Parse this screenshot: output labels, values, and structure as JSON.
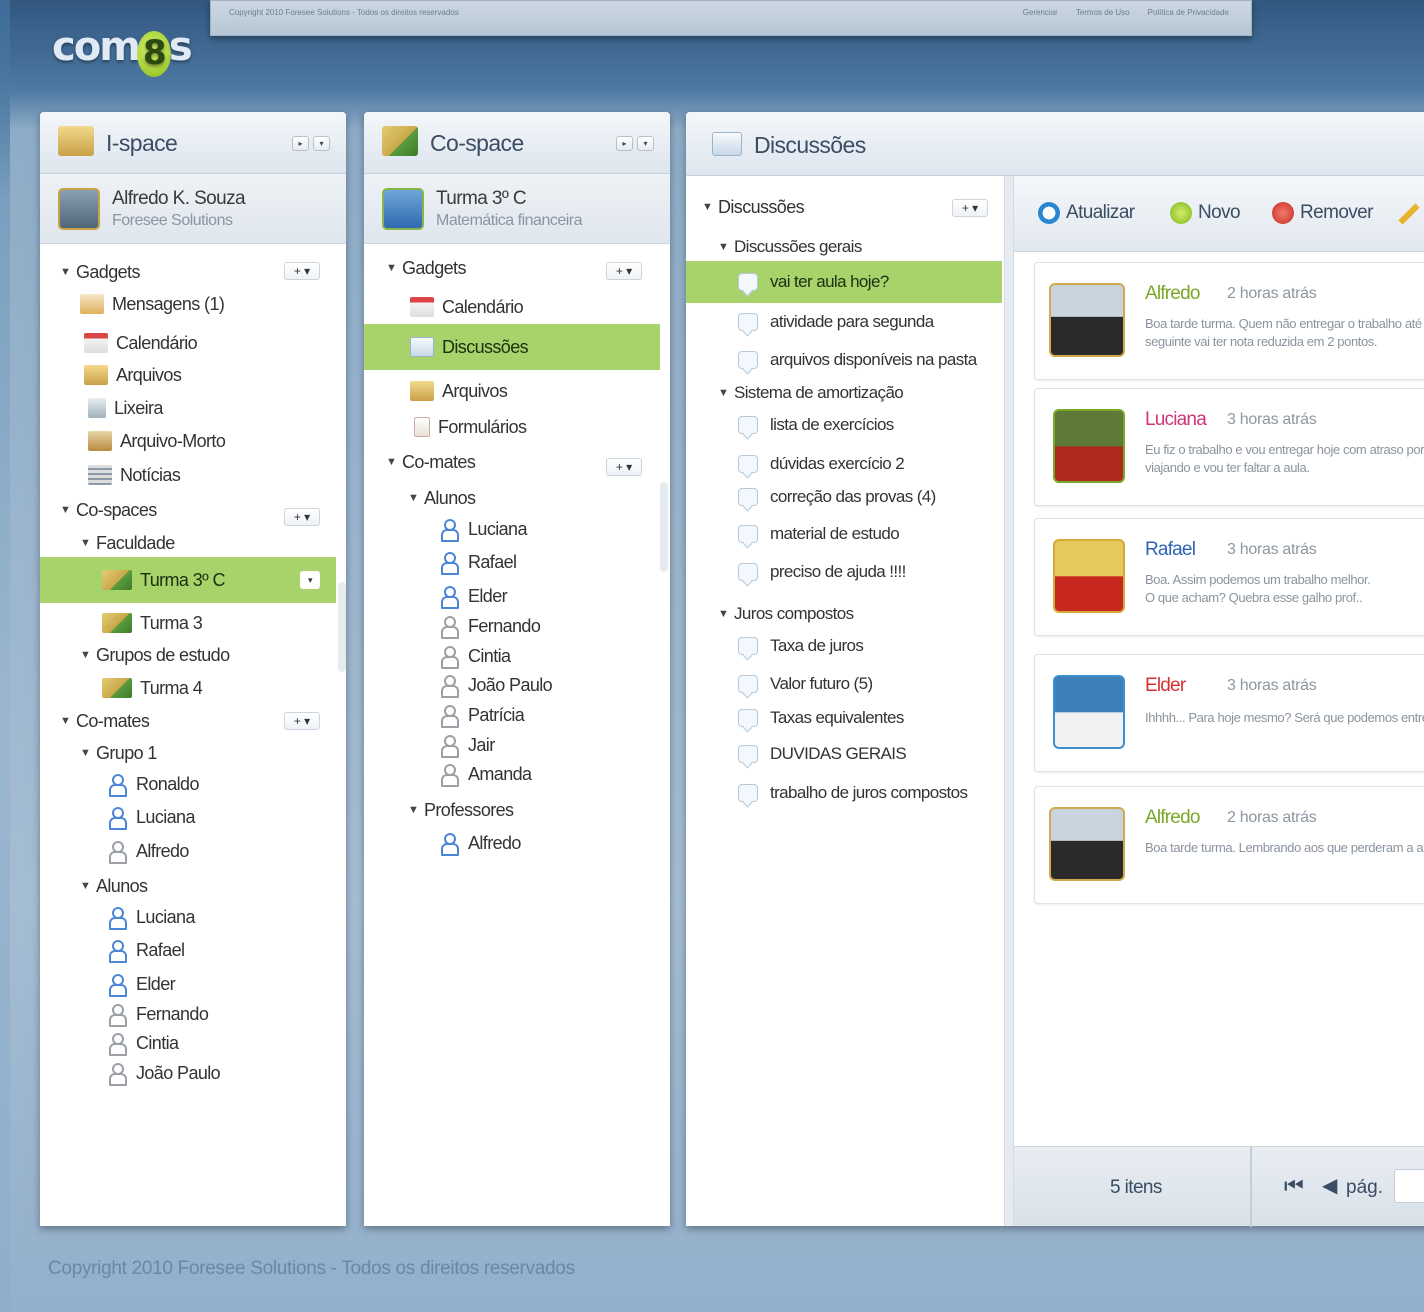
{
  "top_strip": {
    "copyright": "Copyright 2010 Foresee Solutions - Todos os direitos reservados",
    "links": [
      "Gerenciar",
      "Termos de Uso",
      "Política de Privacidade"
    ]
  },
  "logo": {
    "text_left": "com",
    "eight": "8",
    "text_right": "s"
  },
  "ispace": {
    "title": "I-space",
    "user_name": "Alfredo K. Souza",
    "user_org": "Foresee Solutions",
    "gadgets_label": "Gadgets",
    "gadgets": [
      "Mensagens (1)",
      "Calendário",
      "Arquivos",
      "Lixeira",
      "Arquivo-Morto",
      "Notícias"
    ],
    "cospaces_label": "Co-spaces",
    "faculdade_label": "Faculdade",
    "turma3c": "Turma 3º C",
    "turma3": "Turma 3",
    "grupos_label": "Grupos de estudo",
    "turma4": "Turma 4",
    "comates_label": "Co-mates",
    "grupo1_label": "Grupo 1",
    "grupo1": [
      "Ronaldo",
      "Luciana",
      "Alfredo"
    ],
    "alunos_label": "Alunos",
    "alunos": [
      "Luciana",
      "Rafael",
      "Elder",
      "Fernando",
      "Cintia",
      "João Paulo"
    ]
  },
  "cospace": {
    "title": "Co-space",
    "class_name": "Turma 3º C",
    "class_subject": "Matemática financeira",
    "gadgets_label": "Gadgets",
    "gadgets": [
      "Calendário",
      "Discussões",
      "Arquivos",
      "Formulários"
    ],
    "comates_label": "Co-mates",
    "alunos_label": "Alunos",
    "alunos": [
      "Luciana",
      "Rafael",
      "Elder",
      "Fernando",
      "Cintia",
      "João Paulo",
      "Patrícia",
      "Jair",
      "Amanda"
    ],
    "professores_label": "Professores",
    "professores": [
      "Alfredo"
    ]
  },
  "discussions": {
    "title": "Discussões",
    "root_label": "Discussões",
    "groups": [
      {
        "label": "Discussões gerais",
        "items": [
          "vai ter aula hoje?",
          "atividade para segunda",
          "arquivos disponíveis na pasta"
        ]
      },
      {
        "label": "Sistema de amortização",
        "items": [
          "lista de exercícios",
          "dúvidas exercício 2",
          "correção das provas (4)",
          "material de estudo",
          "preciso de ajuda !!!!"
        ]
      },
      {
        "label": "Juros compostos",
        "items": [
          "Taxa de juros",
          "Valor futuro (5)",
          "Taxas equivalentes",
          "DUVIDAS GERAIS",
          "trabalho de juros compostos"
        ]
      }
    ],
    "toolbar": {
      "refresh": "Atualizar",
      "new": "Novo",
      "remove": "Remover"
    },
    "posts": [
      {
        "author": "Alfredo",
        "time": "2 horas atrás",
        "text": "Boa tarde turma. Quem não entregar o trabalho até a semana",
        "text2": "seguinte vai ter nota reduzida em 2 pontos.",
        "color": "#7aa826"
      },
      {
        "author": "Luciana",
        "time": "3 horas atrás",
        "text": "Eu fiz o trabalho e vou entregar hoje com atraso porque estava",
        "text2": "viajando e vou ter faltar a aula.",
        "color": "#d0347a"
      },
      {
        "author": "Rafael",
        "time": "3 horas atrás",
        "text": "Boa. Assim podemos um trabalho melhor.",
        "text2": "O que acham? Quebra esse galho prof..",
        "color": "#2d64b4"
      },
      {
        "author": "Elder",
        "time": "3 horas atrás",
        "text": "Ihhhh... Para hoje mesmo? Será que podemos entregar depois?",
        "text2": "",
        "color": "#d93131"
      },
      {
        "author": "Alfredo",
        "time": "2 horas atrás",
        "text": "Boa tarde turma. Lembrando aos que perderam a aula hoje",
        "text2": "",
        "color": "#7aa826"
      }
    ],
    "items_count": "5 itens",
    "page_label": "pág."
  },
  "footer": "Copyright 2010 Foresee Solutions - Todos os direitos reservados"
}
